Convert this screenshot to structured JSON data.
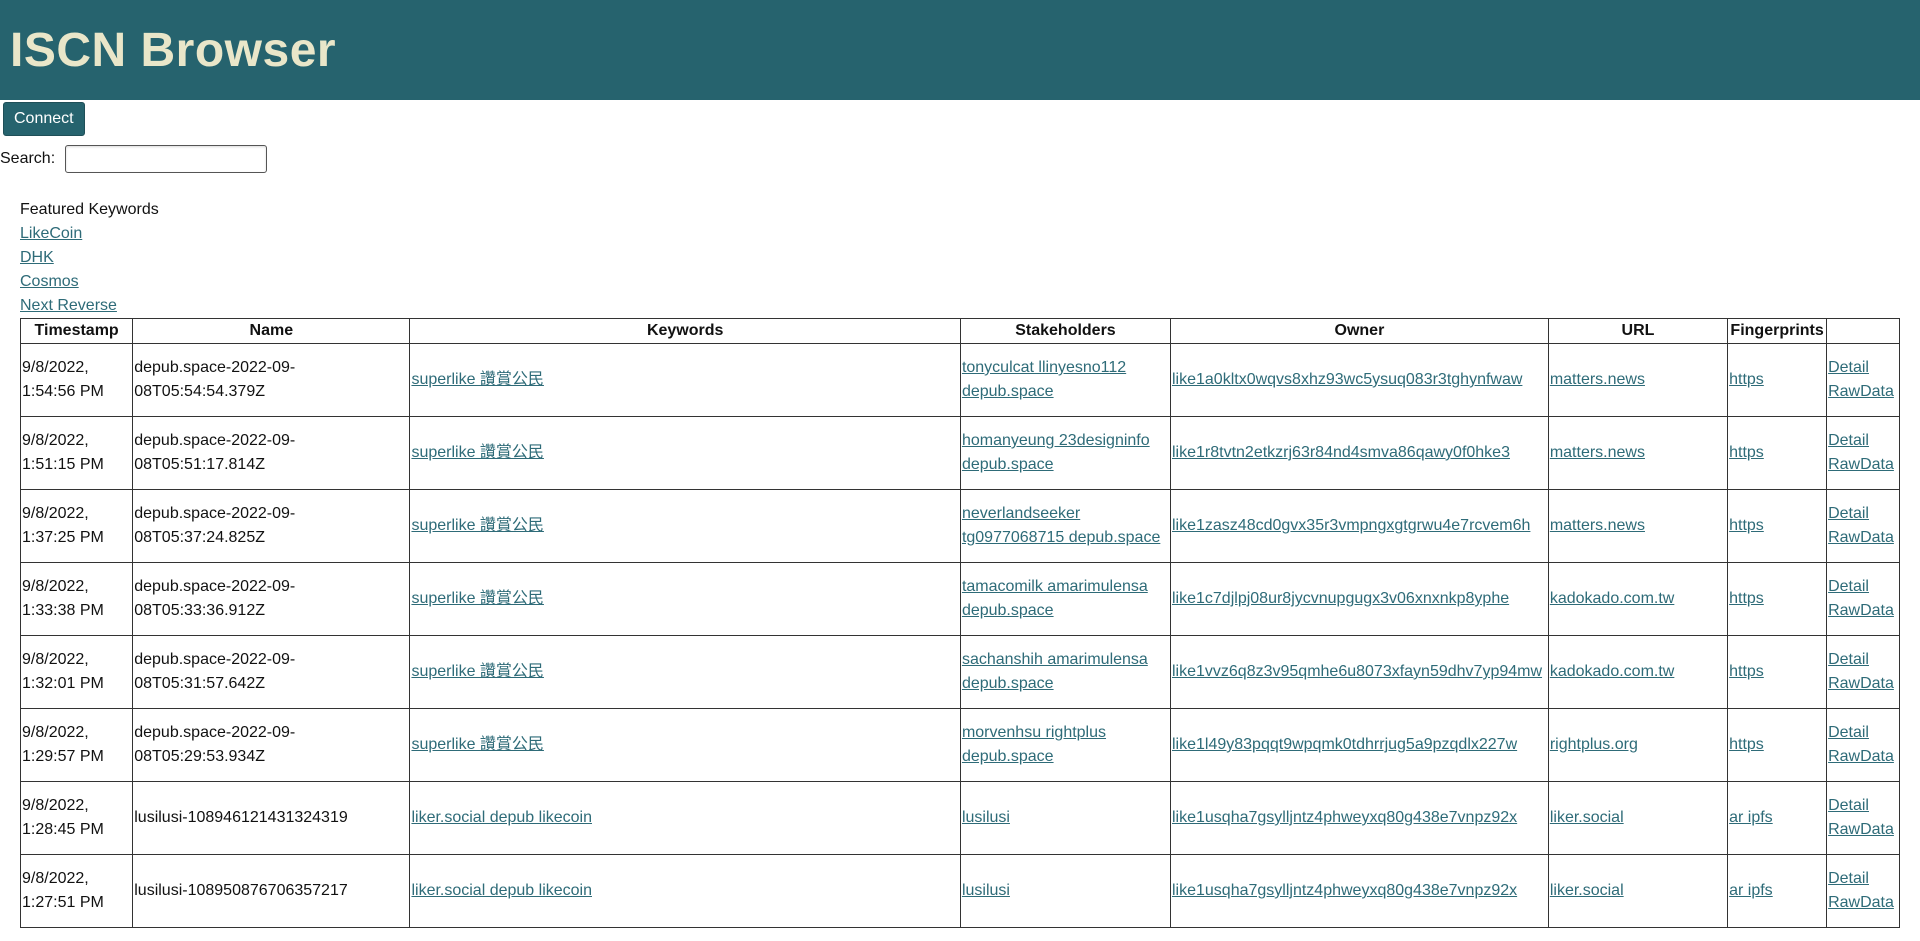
{
  "app": {
    "title": "ISCN Browser"
  },
  "toolbar": {
    "connect_label": "Connect"
  },
  "search": {
    "label": "Search:",
    "value": "",
    "placeholder": ""
  },
  "featured": {
    "heading": "Featured Keywords",
    "keywords": [
      "LikeCoin",
      "DHK",
      "Cosmos"
    ]
  },
  "pagination": {
    "next_reverse": "Next Reverse"
  },
  "table": {
    "headers": [
      "Timestamp",
      "Name",
      "Keywords",
      "Stakeholders",
      "Owner",
      "URL",
      "Fingerprints",
      ""
    ],
    "rows": [
      {
        "timestamp_date": "9/8/2022,",
        "timestamp_time": "1:54:56 PM",
        "name_line1": "depub.space-2022-09-",
        "name_line2": "08T05:54:54.379Z",
        "keywords": "superlike 讚賞公民",
        "stakeholders_line1": "tonyculcat llinyesno112",
        "stakeholders_line2": "depub.space",
        "owner": "like1a0kltx0wqvs8xhz93wc5ysuq083r3tghynfwaw",
        "url": "matters.news",
        "fingerprints": "https",
        "detail": "Detail",
        "rawdata": "RawData"
      },
      {
        "timestamp_date": "9/8/2022,",
        "timestamp_time": "1:51:15 PM",
        "name_line1": "depub.space-2022-09-",
        "name_line2": "08T05:51:17.814Z",
        "keywords": "superlike 讚賞公民",
        "stakeholders_line1": "homanyeung 23designinfo",
        "stakeholders_line2": "depub.space",
        "owner": "like1r8tvtn2etkzrj63r84nd4smva86qawy0f0hke3",
        "url": "matters.news",
        "fingerprints": "https",
        "detail": "Detail",
        "rawdata": "RawData"
      },
      {
        "timestamp_date": "9/8/2022,",
        "timestamp_time": "1:37:25 PM",
        "name_line1": "depub.space-2022-09-",
        "name_line2": "08T05:37:24.825Z",
        "keywords": "superlike 讚賞公民",
        "stakeholders_line1": "neverlandseeker",
        "stakeholders_line2": "tg0977068715 depub.space",
        "owner": "like1zasz48cd0gvx35r3vmpngxgtgrwu4e7rcvem6h",
        "url": "matters.news",
        "fingerprints": "https",
        "detail": "Detail",
        "rawdata": "RawData"
      },
      {
        "timestamp_date": "9/8/2022,",
        "timestamp_time": "1:33:38 PM",
        "name_line1": "depub.space-2022-09-",
        "name_line2": "08T05:33:36.912Z",
        "keywords": "superlike 讚賞公民",
        "stakeholders_line1": "tamacomilk amarimulensa",
        "stakeholders_line2": "depub.space",
        "owner": "like1c7djlpj08ur8jycvnupgugx3v06xnxnkp8yphe",
        "url": "kadokado.com.tw",
        "fingerprints": "https",
        "detail": "Detail",
        "rawdata": "RawData"
      },
      {
        "timestamp_date": "9/8/2022,",
        "timestamp_time": "1:32:01 PM",
        "name_line1": "depub.space-2022-09-",
        "name_line2": "08T05:31:57.642Z",
        "keywords": "superlike 讚賞公民",
        "stakeholders_line1": "sachanshih amarimulensa",
        "stakeholders_line2": "depub.space",
        "owner": "like1vvz6q8z3v95qmhe6u8073xfayn59dhv7yp94mw",
        "url": "kadokado.com.tw",
        "fingerprints": "https",
        "detail": "Detail",
        "rawdata": "RawData"
      },
      {
        "timestamp_date": "9/8/2022,",
        "timestamp_time": "1:29:57 PM",
        "name_line1": "depub.space-2022-09-",
        "name_line2": "08T05:29:53.934Z",
        "keywords": "superlike 讚賞公民",
        "stakeholders_line1": "morvenhsu rightplus",
        "stakeholders_line2": "depub.space",
        "owner": "like1l49y83pqqt9wpqmk0tdhrrjug5a9pzqdlx227w",
        "url": "rightplus.org",
        "fingerprints": "https",
        "detail": "Detail",
        "rawdata": "RawData"
      },
      {
        "timestamp_date": "9/8/2022,",
        "timestamp_time": "1:28:45 PM",
        "name_line1": "lusilusi-108946121431324319",
        "name_line2": "",
        "keywords": "liker.social depub likecoin",
        "stakeholders_line1": "lusilusi",
        "stakeholders_line2": "",
        "owner": "like1usqha7gsylljntz4phweyxq80g438e7vnpz92x",
        "url": "liker.social",
        "fingerprints": "ar ipfs",
        "detail": "Detail",
        "rawdata": "RawData"
      },
      {
        "timestamp_date": "9/8/2022,",
        "timestamp_time": "1:27:51 PM",
        "name_line1": "lusilusi-108950876706357217",
        "name_line2": "",
        "keywords": "liker.social depub likecoin",
        "stakeholders_line1": "lusilusi",
        "stakeholders_line2": "",
        "owner": "like1usqha7gsylljntz4phweyxq80g438e7vnpz92x",
        "url": "liker.social",
        "fingerprints": "ar ipfs",
        "detail": "Detail",
        "rawdata": "RawData"
      }
    ]
  }
}
